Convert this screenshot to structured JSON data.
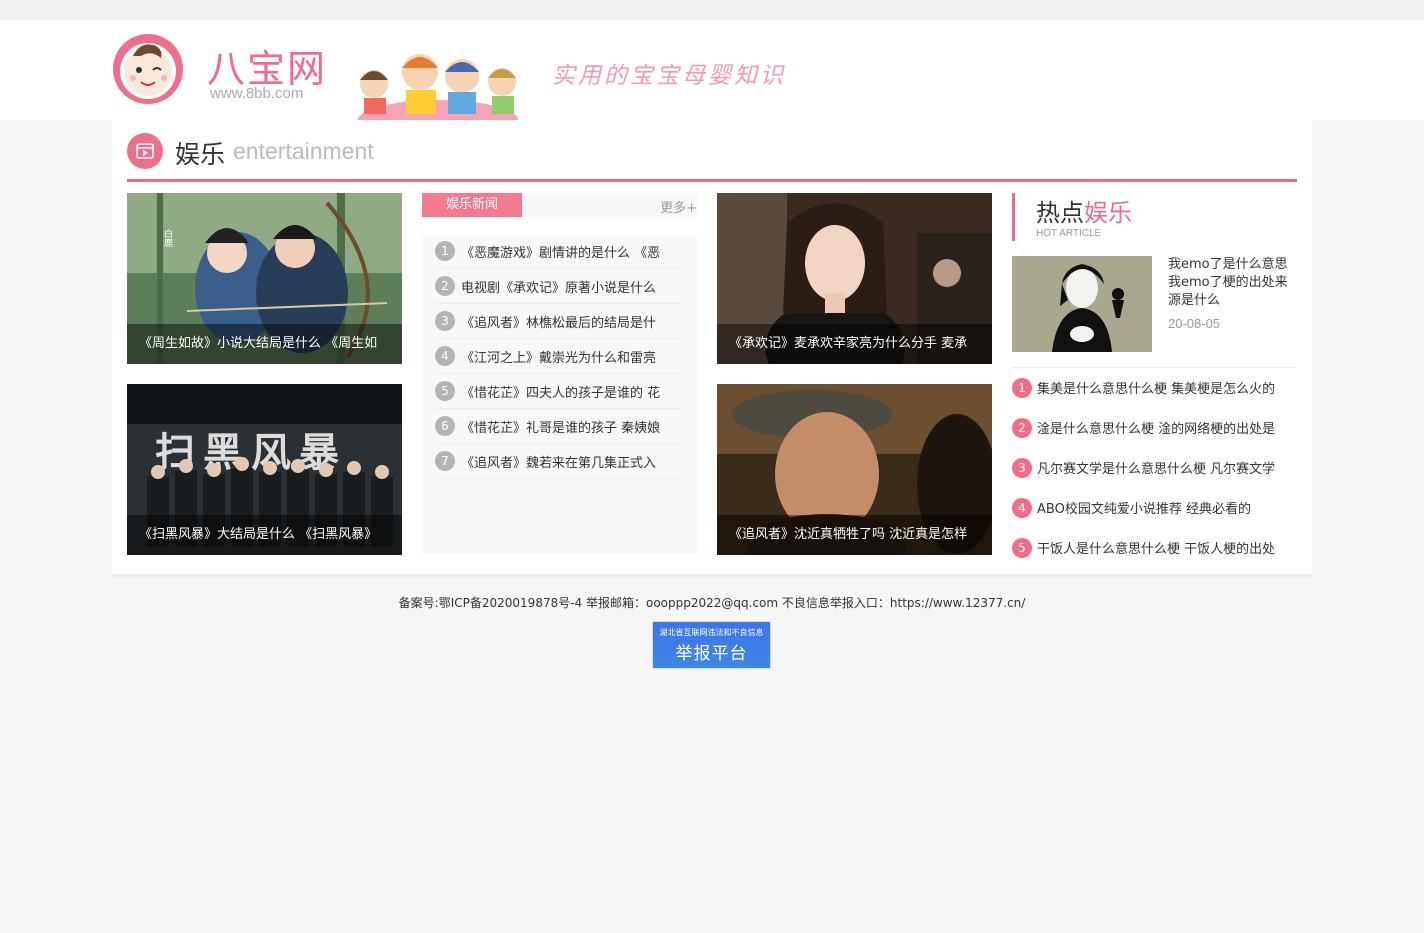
{
  "site": {
    "name": "八宝网",
    "url": "www.8bb.com",
    "slogan": "实用的宝宝母婴知识"
  },
  "section": {
    "title": "娱乐",
    "title_en": "entertainment"
  },
  "cards": [
    {
      "caption": "《周生如故》小说大结局是什么 《周生如"
    },
    {
      "caption": "《扫黑风暴》大结局是什么 《扫黑风暴》"
    },
    {
      "caption": "《承欢记》麦承欢辛家亮为什么分手 麦承"
    },
    {
      "caption": "《追风者》沈近真牺牲了吗 沈近真是怎样"
    }
  ],
  "poster_text": {
    "card1_vertical": "白鹿",
    "card2_title": "扫黑风暴"
  },
  "news": {
    "tab": "娱乐新闻",
    "more": "更多+",
    "items": [
      {
        "num": "1",
        "text": "《恶魔游戏》剧情讲的是什么 《恶"
      },
      {
        "num": "2",
        "text": "电视剧《承欢记》原著小说是什么"
      },
      {
        "num": "3",
        "text": "《追风者》林樵松最后的结局是什"
      },
      {
        "num": "4",
        "text": "《江河之上》戴崇光为什么和雷亮"
      },
      {
        "num": "5",
        "text": "《惜花芷》四夫人的孩子是谁的 花"
      },
      {
        "num": "6",
        "text": "《惜花芷》礼哥是谁的孩子 秦姨娘"
      },
      {
        "num": "7",
        "text": "《追风者》魏若来在第几集正式入"
      }
    ]
  },
  "hot": {
    "title_a": "热点",
    "title_b": "娱乐",
    "subtitle": "HOT ARTICLE",
    "feature_title": "我emo了是什么意思 我emo了梗的出处来源是什么",
    "feature_date": "20-08-05",
    "items": [
      {
        "num": "1",
        "text": "集美是什么意思什么梗 集美梗是怎么火的"
      },
      {
        "num": "2",
        "text": "淦是什么意思什么梗 淦的网络梗的出处是"
      },
      {
        "num": "3",
        "text": "凡尔赛文学是什么意思什么梗 凡尔赛文学"
      },
      {
        "num": "4",
        "text": "ABO校园文纯爱小说推荐 经典必看的"
      },
      {
        "num": "5",
        "text": "干饭人是什么意思什么梗 干饭人梗的出处"
      }
    ]
  },
  "footer": {
    "text": "备案号:鄂ICP备2020019878号-4 举报邮箱：oooppp2022@qq.com 不良信息举报入口：https://www.12377.cn/",
    "report_small": "湖北省互联网违法和不良信息",
    "report_big": "举报平台"
  },
  "colors": {
    "accent": "#ec6a8c",
    "tab": "#f47b8e",
    "report_blue": "#3e7de8"
  }
}
